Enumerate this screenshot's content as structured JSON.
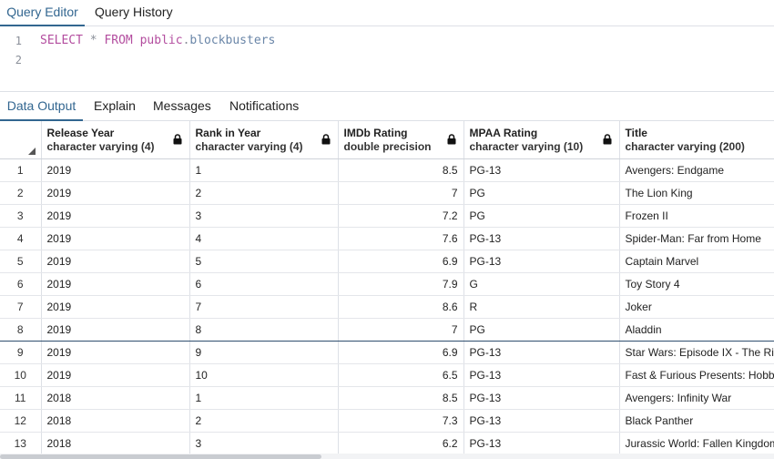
{
  "editor_tabs": [
    {
      "label": "Query Editor",
      "active": true
    },
    {
      "label": "Query History",
      "active": false
    }
  ],
  "editor": {
    "line_numbers": [
      "1",
      "2"
    ],
    "sql": {
      "kw_select": "SELECT",
      "star": "*",
      "kw_from": "FROM",
      "schema": "public",
      "dot": ".",
      "table": "blockbusters"
    }
  },
  "output_tabs": [
    {
      "label": "Data Output",
      "active": true
    },
    {
      "label": "Explain",
      "active": false
    },
    {
      "label": "Messages",
      "active": false
    },
    {
      "label": "Notifications",
      "active": false
    }
  ],
  "columns": [
    {
      "name": "Release Year",
      "type": "character varying (4)",
      "locked": true
    },
    {
      "name": "Rank in Year",
      "type": "character varying (4)",
      "locked": true
    },
    {
      "name": "IMDb Rating",
      "type": "double precision",
      "locked": true
    },
    {
      "name": "MPAA Rating",
      "type": "character varying (10)",
      "locked": true
    },
    {
      "name": "Title",
      "type": "character varying (200)",
      "locked": true
    }
  ],
  "rows": [
    {
      "n": "1",
      "year": "2019",
      "rank": "1",
      "imdb": "8.5",
      "mpaa": "PG-13",
      "title": "Avengers: Endgame"
    },
    {
      "n": "2",
      "year": "2019",
      "rank": "2",
      "imdb": "7",
      "mpaa": "PG",
      "title": "The Lion King"
    },
    {
      "n": "3",
      "year": "2019",
      "rank": "3",
      "imdb": "7.2",
      "mpaa": "PG",
      "title": "Frozen II"
    },
    {
      "n": "4",
      "year": "2019",
      "rank": "4",
      "imdb": "7.6",
      "mpaa": "PG-13",
      "title": "Spider-Man: Far from Home"
    },
    {
      "n": "5",
      "year": "2019",
      "rank": "5",
      "imdb": "6.9",
      "mpaa": "PG-13",
      "title": "Captain Marvel"
    },
    {
      "n": "6",
      "year": "2019",
      "rank": "6",
      "imdb": "7.9",
      "mpaa": "G",
      "title": "Toy Story 4"
    },
    {
      "n": "7",
      "year": "2019",
      "rank": "7",
      "imdb": "8.6",
      "mpaa": "R",
      "title": "Joker"
    },
    {
      "n": "8",
      "year": "2019",
      "rank": "8",
      "imdb": "7",
      "mpaa": "PG",
      "title": "Aladdin",
      "selected": true
    },
    {
      "n": "9",
      "year": "2019",
      "rank": "9",
      "imdb": "6.9",
      "mpaa": "PG-13",
      "title": "Star Wars: Episode IX - The Rise of Skywalker"
    },
    {
      "n": "10",
      "year": "2019",
      "rank": "10",
      "imdb": "6.5",
      "mpaa": "PG-13",
      "title": "Fast & Furious Presents: Hobbs & Shaw"
    },
    {
      "n": "11",
      "year": "2018",
      "rank": "1",
      "imdb": "8.5",
      "mpaa": "PG-13",
      "title": "Avengers: Infinity War"
    },
    {
      "n": "12",
      "year": "2018",
      "rank": "2",
      "imdb": "7.3",
      "mpaa": "PG-13",
      "title": "Black Panther"
    },
    {
      "n": "13",
      "year": "2018",
      "rank": "3",
      "imdb": "6.2",
      "mpaa": "PG-13",
      "title": "Jurassic World: Fallen Kingdom"
    }
  ],
  "colors": {
    "accent": "#326690",
    "keyword": "#b34d9f",
    "identifier": "#6a86a8"
  }
}
